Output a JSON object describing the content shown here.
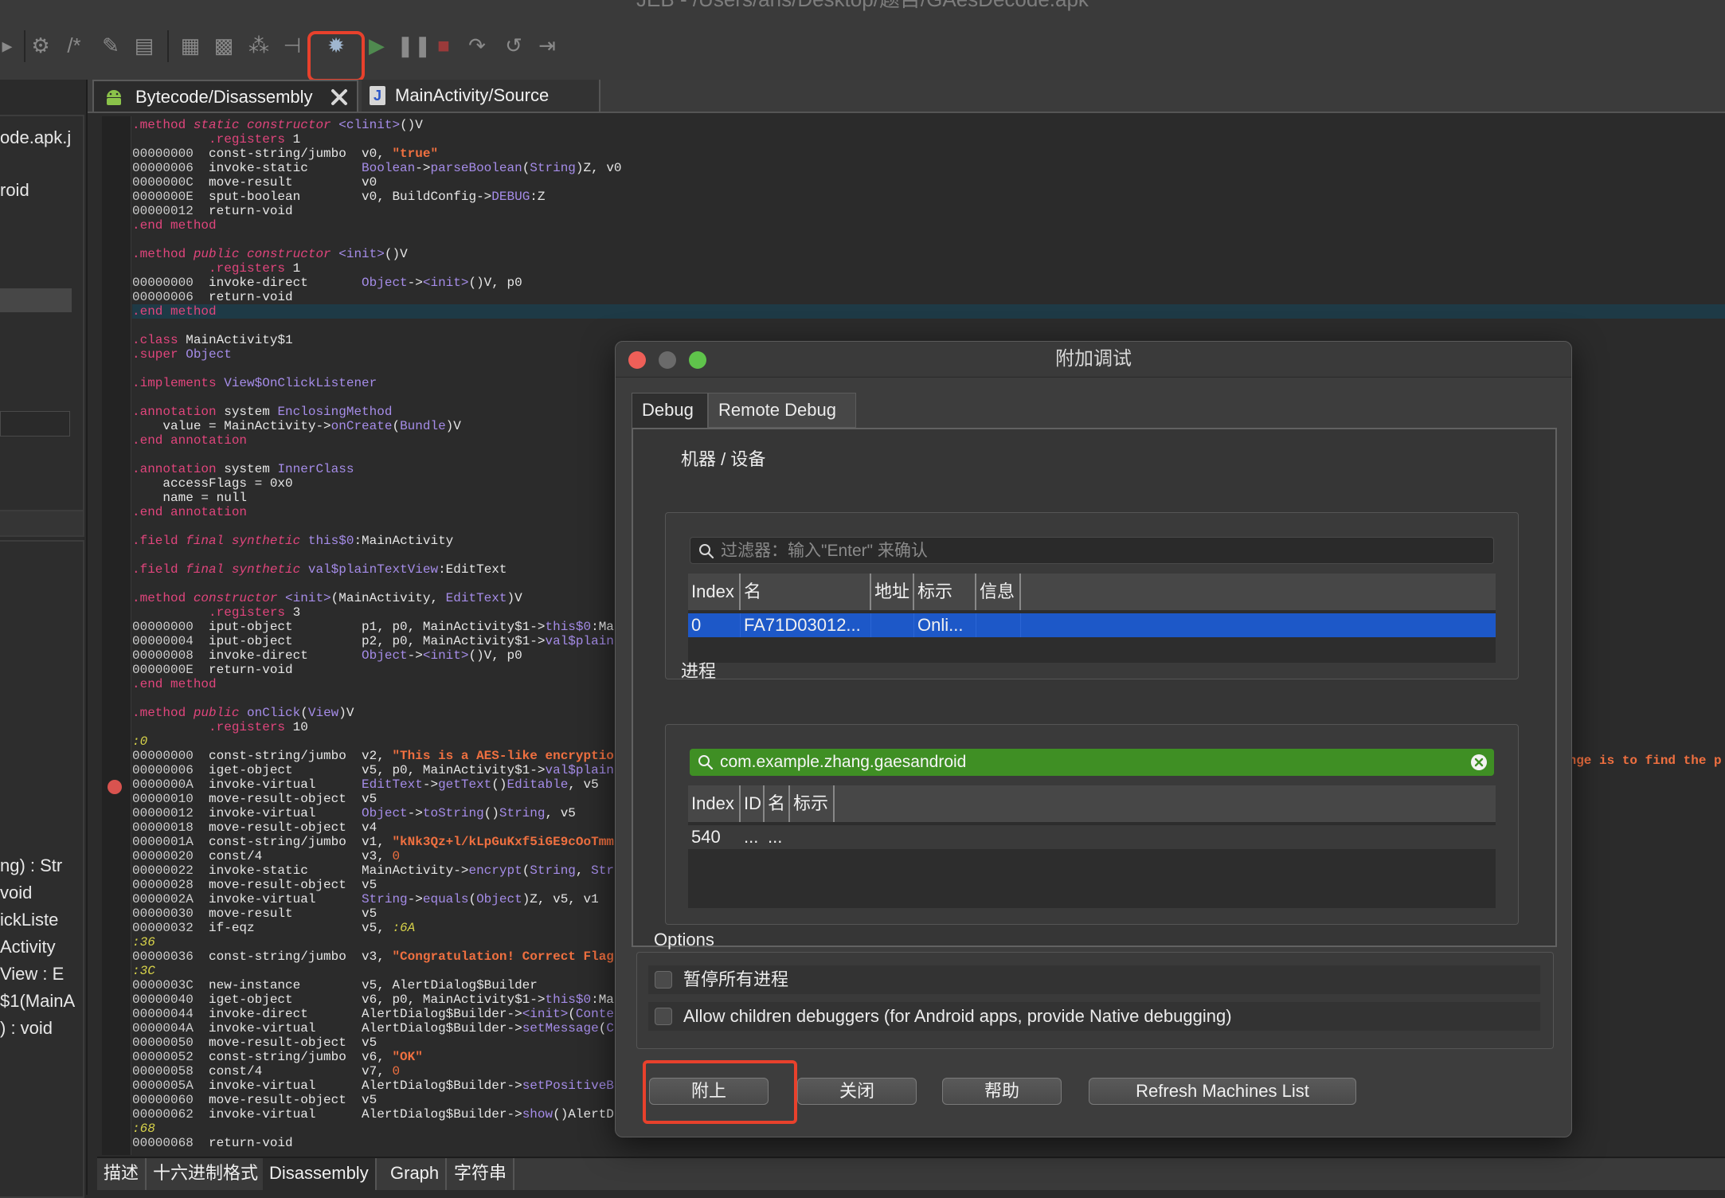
{
  "window": {
    "title": "JEB - /Users/ans/Desktop/题目/GAesDecode.apk"
  },
  "toolbar": {
    "icons": [
      "play-icon",
      "settings-icon",
      "comment-icon",
      "pencil-icon",
      "document-icon",
      "grid-icon",
      "grid-alt-icon",
      "nodes-icon",
      "tree-icon",
      "attach-debugger-icon",
      "run-icon",
      "pause-icon",
      "stop-icon",
      "step-over-icon",
      "step-into-icon",
      "step-out-icon"
    ]
  },
  "left_panel": {
    "project_fragments": [
      "ode.apk.j",
      "roid"
    ],
    "method_fragments": [
      "ng) : Str",
      " void",
      "ickListe",
      "Activity",
      "View : E",
      "$1(MainA",
      ") : void"
    ]
  },
  "editor_tabs": [
    {
      "label": "Bytecode/Disassembly",
      "icon": "android-icon",
      "active": true
    },
    {
      "label": "MainActivity/Source",
      "icon": "java-file-icon",
      "active": false
    }
  ],
  "code_lines": [
    [
      {
        "t": ".method ",
        "c": "kw"
      },
      {
        "t": "static constructor ",
        "c": "kwi"
      },
      {
        "t": "<clinit>",
        "c": "purp"
      },
      {
        "t": "()V"
      }
    ],
    [
      {
        "t": "          "
      },
      {
        "t": ".registers ",
        "c": "kw"
      },
      {
        "t": "1"
      }
    ],
    [
      {
        "t": "00000000  ",
        "c": "off"
      },
      {
        "t": "const-string/jumbo  v0, "
      },
      {
        "t": "\"true\"",
        "c": "str"
      }
    ],
    [
      {
        "t": "00000006  ",
        "c": "off"
      },
      {
        "t": "invoke-static       "
      },
      {
        "t": "Boolean",
        "c": "purp"
      },
      {
        "t": "->"
      },
      {
        "t": "parseBoolean",
        "c": "purp"
      },
      {
        "t": "("
      },
      {
        "t": "String",
        "c": "purp"
      },
      {
        "t": ")Z, v0"
      }
    ],
    [
      {
        "t": "0000000C  ",
        "c": "off"
      },
      {
        "t": "move-result         v0"
      }
    ],
    [
      {
        "t": "0000000E  ",
        "c": "off"
      },
      {
        "t": "sput-boolean        v0, BuildConfig->"
      },
      {
        "t": "DEBUG",
        "c": "purp"
      },
      {
        "t": ":Z"
      }
    ],
    [
      {
        "t": "00000012  ",
        "c": "off"
      },
      {
        "t": "return-void"
      }
    ],
    [
      {
        "t": ".end method",
        "c": "kw"
      }
    ],
    [
      {
        "t": ""
      }
    ],
    [
      {
        "t": ".method ",
        "c": "kw"
      },
      {
        "t": "public constructor ",
        "c": "kwi"
      },
      {
        "t": "<init>",
        "c": "purp"
      },
      {
        "t": "()V"
      }
    ],
    [
      {
        "t": "          "
      },
      {
        "t": ".registers ",
        "c": "kw"
      },
      {
        "t": "1"
      }
    ],
    [
      {
        "t": "00000000  ",
        "c": "off"
      },
      {
        "t": "invoke-direct       "
      },
      {
        "t": "Object",
        "c": "purp"
      },
      {
        "t": "->"
      },
      {
        "t": "<init>",
        "c": "purp"
      },
      {
        "t": "()V, p0"
      }
    ],
    [
      {
        "t": "00000006  ",
        "c": "off"
      },
      {
        "t": "return-void"
      }
    ],
    [
      {
        "t": ".end method",
        "c": "kw",
        "hl": true
      }
    ],
    [
      {
        "t": ""
      }
    ],
    [
      {
        "t": ".class ",
        "c": "kw"
      },
      {
        "t": "MainActivity$1"
      }
    ],
    [
      {
        "t": ".super ",
        "c": "kw"
      },
      {
        "t": "Object",
        "c": "purp"
      }
    ],
    [
      {
        "t": ""
      }
    ],
    [
      {
        "t": ".implements ",
        "c": "kw"
      },
      {
        "t": "View$OnClickListener",
        "c": "purp"
      }
    ],
    [
      {
        "t": ""
      }
    ],
    [
      {
        "t": ".annotation ",
        "c": "kw"
      },
      {
        "t": "system "
      },
      {
        "t": "EnclosingMethod",
        "c": "purp"
      }
    ],
    [
      {
        "t": "    value = MainActivity->"
      },
      {
        "t": "onCreate",
        "c": "purp"
      },
      {
        "t": "("
      },
      {
        "t": "Bundle",
        "c": "purp"
      },
      {
        "t": ")V"
      }
    ],
    [
      {
        "t": ".end annotation",
        "c": "kw"
      }
    ],
    [
      {
        "t": ""
      }
    ],
    [
      {
        "t": ".annotation ",
        "c": "kw"
      },
      {
        "t": "system "
      },
      {
        "t": "InnerClass",
        "c": "purp"
      }
    ],
    [
      {
        "t": "    accessFlags = 0x0"
      }
    ],
    [
      {
        "t": "    name = null"
      }
    ],
    [
      {
        "t": ".end annotation",
        "c": "kw"
      }
    ],
    [
      {
        "t": ""
      }
    ],
    [
      {
        "t": ".field ",
        "c": "kw"
      },
      {
        "t": "final synthetic ",
        "c": "kwi"
      },
      {
        "t": "this$0",
        "c": "purp"
      },
      {
        "t": ":MainActivity"
      }
    ],
    [
      {
        "t": ""
      }
    ],
    [
      {
        "t": ".field ",
        "c": "kw"
      },
      {
        "t": "final synthetic ",
        "c": "kwi"
      },
      {
        "t": "val$plainTextView",
        "c": "purp"
      },
      {
        "t": ":EditText"
      }
    ],
    [
      {
        "t": ""
      }
    ],
    [
      {
        "t": ".method ",
        "c": "kw"
      },
      {
        "t": "constructor ",
        "c": "kwi"
      },
      {
        "t": "<init>",
        "c": "purp"
      },
      {
        "t": "(MainActivity, "
      },
      {
        "t": "EditText",
        "c": "purp"
      },
      {
        "t": ")V"
      }
    ],
    [
      {
        "t": "          "
      },
      {
        "t": ".registers ",
        "c": "kw"
      },
      {
        "t": "3"
      }
    ],
    [
      {
        "t": "00000000  ",
        "c": "off"
      },
      {
        "t": "iput-object         p1, p0, MainActivity$1->"
      },
      {
        "t": "this$0",
        "c": "purp"
      },
      {
        "t": ":Ma"
      }
    ],
    [
      {
        "t": "00000004  ",
        "c": "off"
      },
      {
        "t": "iput-object         p2, p0, MainActivity$1->"
      },
      {
        "t": "val$plain",
        "c": "purp"
      }
    ],
    [
      {
        "t": "00000008  ",
        "c": "off"
      },
      {
        "t": "invoke-direct       "
      },
      {
        "t": "Object",
        "c": "purp"
      },
      {
        "t": "->"
      },
      {
        "t": "<init>",
        "c": "purp"
      },
      {
        "t": "()V, p0"
      }
    ],
    [
      {
        "t": "0000000E  ",
        "c": "off"
      },
      {
        "t": "return-void"
      }
    ],
    [
      {
        "t": ".end method",
        "c": "kw"
      }
    ],
    [
      {
        "t": ""
      }
    ],
    [
      {
        "t": ".method ",
        "c": "kw"
      },
      {
        "t": "public ",
        "c": "kwi"
      },
      {
        "t": "onClick",
        "c": "purp"
      },
      {
        "t": "("
      },
      {
        "t": "View",
        "c": "purp"
      },
      {
        "t": ")V"
      }
    ],
    [
      {
        "t": "          "
      },
      {
        "t": ".registers ",
        "c": "kw"
      },
      {
        "t": "10"
      }
    ],
    [
      {
        "t": ":0",
        "c": "lbl"
      }
    ],
    [
      {
        "t": "00000000  ",
        "c": "off"
      },
      {
        "t": "const-string/jumbo  v2, "
      },
      {
        "t": "\"This is a AES-like encryptio",
        "c": "str"
      }
    ],
    [
      {
        "t": "00000006  ",
        "c": "off"
      },
      {
        "t": "iget-object         v5, p0, MainActivity$1->"
      },
      {
        "t": "val$plain",
        "c": "purp"
      }
    ],
    [
      {
        "t": "0000000A  ",
        "c": "off"
      },
      {
        "t": "invoke-virtual      "
      },
      {
        "t": "EditText",
        "c": "purp"
      },
      {
        "t": "->"
      },
      {
        "t": "getText",
        "c": "purp"
      },
      {
        "t": "()"
      },
      {
        "t": "Editable",
        "c": "purp"
      },
      {
        "t": ", v5"
      }
    ],
    [
      {
        "t": "00000010  ",
        "c": "off"
      },
      {
        "t": "move-result-object  v5"
      }
    ],
    [
      {
        "t": "00000012  ",
        "c": "off"
      },
      {
        "t": "invoke-virtual      "
      },
      {
        "t": "Object",
        "c": "purp"
      },
      {
        "t": "->"
      },
      {
        "t": "toString",
        "c": "purp"
      },
      {
        "t": "()"
      },
      {
        "t": "String",
        "c": "purp"
      },
      {
        "t": ", v5"
      }
    ],
    [
      {
        "t": "00000018  ",
        "c": "off"
      },
      {
        "t": "move-result-object  v4"
      }
    ],
    [
      {
        "t": "0000001A  ",
        "c": "off"
      },
      {
        "t": "const-string/jumbo  v1, "
      },
      {
        "t": "\"kNk3Qz+l/kLpGuKxf5iGE9cOoTmm",
        "c": "str"
      }
    ],
    [
      {
        "t": "00000020  ",
        "c": "off"
      },
      {
        "t": "const/4             v3, "
      },
      {
        "t": "0",
        "c": "num"
      }
    ],
    [
      {
        "t": "00000022  ",
        "c": "off"
      },
      {
        "t": "invoke-static       MainActivity->"
      },
      {
        "t": "encrypt",
        "c": "purp"
      },
      {
        "t": "("
      },
      {
        "t": "String",
        "c": "purp"
      },
      {
        "t": ", "
      },
      {
        "t": "Str",
        "c": "purp"
      }
    ],
    [
      {
        "t": "00000028  ",
        "c": "off"
      },
      {
        "t": "move-result-object  v5"
      }
    ],
    [
      {
        "t": "0000002A  ",
        "c": "off"
      },
      {
        "t": "invoke-virtual      "
      },
      {
        "t": "String",
        "c": "purp"
      },
      {
        "t": "->"
      },
      {
        "t": "equals",
        "c": "purp"
      },
      {
        "t": "("
      },
      {
        "t": "Object",
        "c": "purp"
      },
      {
        "t": ")Z, v5, v1"
      }
    ],
    [
      {
        "t": "00000030  ",
        "c": "off"
      },
      {
        "t": "move-result         v5"
      }
    ],
    [
      {
        "t": "00000032  ",
        "c": "off"
      },
      {
        "t": "if-eqz              v5, "
      },
      {
        "t": ":6A",
        "c": "lbl"
      }
    ],
    [
      {
        "t": ":36",
        "c": "lbl"
      }
    ],
    [
      {
        "t": "00000036  ",
        "c": "off"
      },
      {
        "t": "const-string/jumbo  v3, "
      },
      {
        "t": "\"Congratulation! Correct Flag",
        "c": "str"
      }
    ],
    [
      {
        "t": ":3C",
        "c": "lbl"
      }
    ],
    [
      {
        "t": "0000003C  ",
        "c": "off"
      },
      {
        "t": "new-instance        v5, AlertDialog$Builder"
      }
    ],
    [
      {
        "t": "00000040  ",
        "c": "off"
      },
      {
        "t": "iget-object         v6, p0, MainActivity$1->"
      },
      {
        "t": "this$0",
        "c": "purp"
      },
      {
        "t": ":Ma"
      }
    ],
    [
      {
        "t": "00000044  ",
        "c": "off"
      },
      {
        "t": "invoke-direct       AlertDialog$Builder->"
      },
      {
        "t": "<init>",
        "c": "purp"
      },
      {
        "t": "("
      },
      {
        "t": "Conte",
        "c": "purp"
      }
    ],
    [
      {
        "t": "0000004A  ",
        "c": "off"
      },
      {
        "t": "invoke-virtual      AlertDialog$Builder->"
      },
      {
        "t": "setMessage",
        "c": "purp"
      },
      {
        "t": "("
      },
      {
        "t": "C",
        "c": "purp"
      }
    ],
    [
      {
        "t": "00000050  ",
        "c": "off"
      },
      {
        "t": "move-result-object  v5"
      }
    ],
    [
      {
        "t": "00000052  ",
        "c": "off"
      },
      {
        "t": "const-string/jumbo  v6, "
      },
      {
        "t": "\"OK\"",
        "c": "str"
      }
    ],
    [
      {
        "t": "00000058  ",
        "c": "off"
      },
      {
        "t": "const/4             v7, "
      },
      {
        "t": "0",
        "c": "num"
      }
    ],
    [
      {
        "t": "0000005A  ",
        "c": "off"
      },
      {
        "t": "invoke-virtual      AlertDialog$Builder->"
      },
      {
        "t": "setPositiveB",
        "c": "purp"
      }
    ],
    [
      {
        "t": "00000060  ",
        "c": "off"
      },
      {
        "t": "move-result-object  v5"
      }
    ],
    [
      {
        "t": "00000062  ",
        "c": "off"
      },
      {
        "t": "invoke-virtual      AlertDialog$Builder->"
      },
      {
        "t": "show",
        "c": "purp"
      },
      {
        "t": "()AlertD"
      }
    ],
    [
      {
        "t": ":68",
        "c": "lbl"
      }
    ],
    [
      {
        "t": "00000068  ",
        "c": "off"
      },
      {
        "t": "return-void"
      }
    ]
  ],
  "code_edge_text": "enge is to find the p",
  "bottom_tabs": [
    {
      "label": "描述",
      "active": false
    },
    {
      "label": "十六进制格式",
      "active": false
    },
    {
      "label": "Disassembly",
      "active": true
    },
    {
      "label": "Graph",
      "active": false
    },
    {
      "label": "字符串",
      "active": false
    }
  ],
  "dialog": {
    "title": "附加调试",
    "tabs": [
      {
        "label": "Debug",
        "active": true
      },
      {
        "label": "Remote Debug",
        "active": false
      }
    ],
    "machines_group": "机器 / 设备",
    "machine_filter_placeholder": "过滤器：输入\"Enter\" 来确认",
    "machine_columns": [
      "Index",
      "名",
      "地址",
      "标示",
      "信息"
    ],
    "machine_rows": [
      [
        "0",
        "FA71D03012...",
        "",
        "Onli...",
        ""
      ]
    ],
    "process_group": "进程",
    "process_filter_value": "com.example.zhang.gaesandroid",
    "process_columns": [
      "Index",
      "ID",
      "名",
      "标示"
    ],
    "process_rows": [
      [
        "540",
        "...",
        "...",
        ""
      ]
    ],
    "options_label": "Options",
    "option_suspend": "暂停所有进程",
    "option_children": "Allow children debuggers (for Android apps, provide Native debugging)",
    "buttons": {
      "attach": "附上",
      "close": "关闭",
      "help": "帮助",
      "refresh": "Refresh Machines List"
    },
    "colors": {
      "filter_active": "#3f8f24",
      "row_selected": "#1d58c8",
      "highlight": "#e8412c"
    }
  }
}
